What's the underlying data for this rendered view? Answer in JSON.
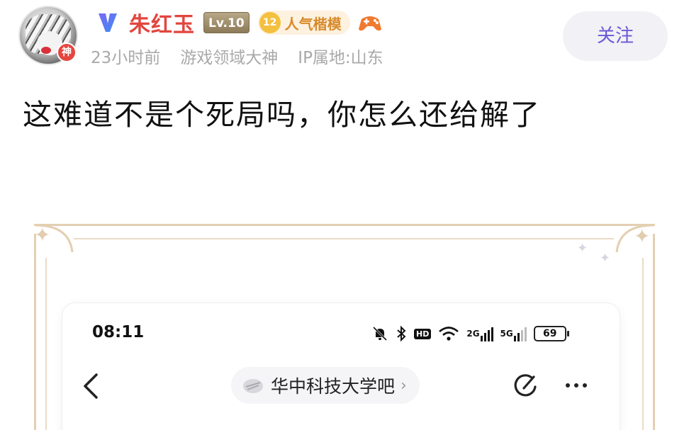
{
  "post": {
    "author": {
      "name": "朱红玉",
      "level": "Lv.10",
      "popularity_level": "12",
      "popularity_title": "人气楷模",
      "avatar_badge": "神"
    },
    "meta": {
      "time": "23小时前",
      "title": "游戏领域大神",
      "ip": "IP属地:山东"
    },
    "follow_label": "关注",
    "content": "这难道不是个死局吗，你怎么还给解了"
  },
  "embedded_screenshot": {
    "status_bar": {
      "time": "08:11",
      "hd_label": "HD",
      "network_1": "2G",
      "network_2": "5G",
      "battery": "69"
    },
    "forum": {
      "name": "华中科技大学吧",
      "chevron": "›"
    }
  },
  "colors": {
    "username": "#e2463f",
    "follow_text": "#6a58d6",
    "meta_text": "#a9a9a9",
    "frame": "#e4cfb2",
    "popularity_badge": "#f4c03f"
  },
  "icons": {
    "verified": "v-shield-icon",
    "controller": "game-controller-icon",
    "mute": "bell-off-icon",
    "bluetooth": "bluetooth-icon",
    "wifi": "wifi-icon",
    "back": "chevron-left-icon",
    "share": "share-icon",
    "more": "more-horizontal-icon"
  }
}
